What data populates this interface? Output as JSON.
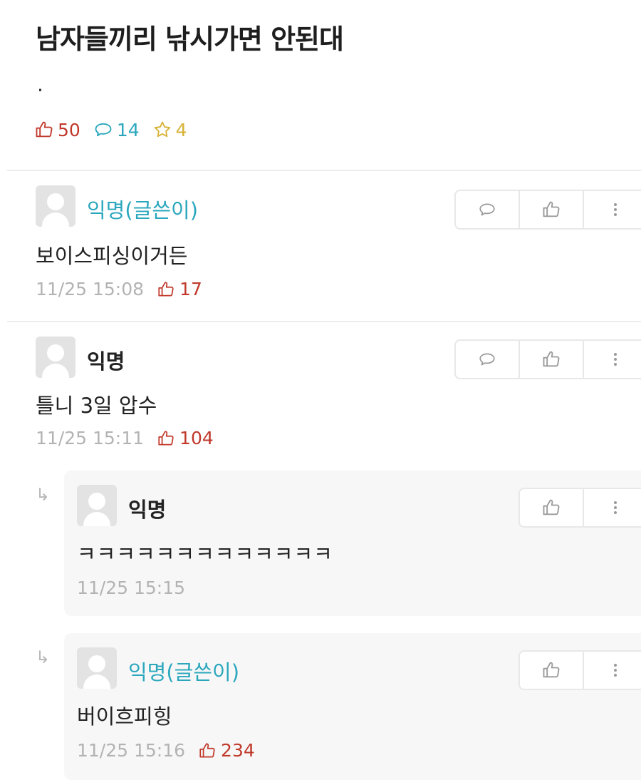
{
  "post": {
    "title": "남자들끼리 낚시가면 안된대",
    "body": ".",
    "stats": {
      "likes": "50",
      "comments": "14",
      "scraps": "4"
    }
  },
  "comments": [
    {
      "author": "익명(글쓴이)",
      "text": "보이스피싱이거든",
      "time": "11/25 15:08",
      "likes": "17",
      "is_op": true
    },
    {
      "author": "익명",
      "text": "틀니 3일 압수",
      "time": "11/25 15:11",
      "likes": "104",
      "is_op": false
    },
    {
      "author": "익명",
      "text": "ㅋㅋㅋㅋㅋㅋㅋㅋㅋㅋㅋㅋㅋ",
      "time": "11/25 15:15",
      "likes": "",
      "is_op": false,
      "is_reply": true
    },
    {
      "author": "익명(글쓴이)",
      "text": "버이흐피힝",
      "time": "11/25 15:16",
      "likes": "234",
      "is_op": true,
      "is_reply": true
    }
  ],
  "icons": {
    "like": "thumbs-up-icon",
    "comment": "speech-bubble-icon",
    "scrap": "star-icon",
    "more": "more-vertical-icon",
    "reply": "reply-arrow-icon"
  },
  "colors": {
    "like": "#c0392b",
    "comment": "#2aa7bd",
    "scrap": "#d7b236",
    "op_author": "#2aa7bd",
    "meta": "#b3b3b3"
  }
}
